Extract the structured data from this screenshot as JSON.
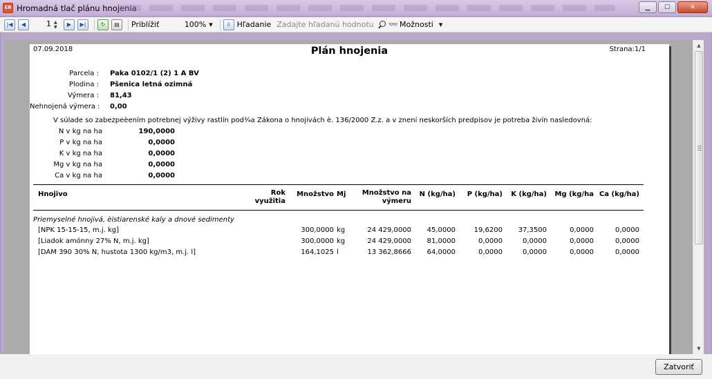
{
  "window": {
    "title": "Hromadná tlač plánu hnojenia",
    "app_icon": "ER"
  },
  "toolbar": {
    "page_number": "1",
    "zoom_label": "Priblížiť",
    "zoom_value": "100%",
    "search_label": "Hľadanie",
    "search_placeholder": "Zadajte hľadanú hodnotu",
    "options_label": "Možnosti"
  },
  "report": {
    "date": "07.09.2018",
    "title": "Plán hnojenia",
    "page": "Strana:1/1",
    "info": [
      {
        "label": "Parcela :",
        "value": "Paka 0102/1 (2) 1 A BV"
      },
      {
        "label": "Plodina :",
        "value": "Pšenica letná ozimná"
      },
      {
        "label": "Výmera :",
        "value": "81,43"
      },
      {
        "label": "Nehnojená výmera :",
        "value": "0,00"
      }
    ],
    "intro": "V súlade so zabezpeèením potrebnej výživy rastlín pod¾a Zákona o hnojivách è. 136/2000 Z.z. a v znení neskorších predpisov je potreba živín nasledovná:",
    "nutrients": [
      {
        "label": "N v kg na ha",
        "value": "190,0000"
      },
      {
        "label": "P v kg na ha",
        "value": "0,0000"
      },
      {
        "label": "K v kg na ha",
        "value": "0,0000"
      },
      {
        "label": "Mg v kg na ha",
        "value": "0,0000"
      },
      {
        "label": "Ca v kg na ha",
        "value": "0,0000"
      }
    ],
    "columns": {
      "fertilizer": "Hnojivo",
      "year_use_1": "Rok",
      "year_use_2": "využitia",
      "quantity": "Množstvo",
      "unit": "Mj",
      "qty_area_1": "Množstvo na",
      "qty_area_2": "výmeru",
      "n": "N (kg/ha)",
      "p": "P (kg/ha)",
      "k": "K (kg/ha)",
      "mg": "Mg (kg/ha",
      "ca": "Ca (kg/ha)"
    },
    "group": "Priemyselné hnojivá, èistiarenské kaly a dnové sedimenty",
    "rows": [
      {
        "name": "[NPK 15-15-15, m.j. kg]",
        "quantity": "300,0000",
        "unit": "kg",
        "qty_area": "24 429,0000",
        "n": "45,0000",
        "p": "19,6200",
        "k": "37,3500",
        "mg": "0,0000",
        "ca": "0,0000"
      },
      {
        "name": "[Liadok amónny 27% N, m.j. kg]",
        "quantity": "300,0000",
        "unit": "kg",
        "qty_area": "24 429,0000",
        "n": "81,0000",
        "p": "0,0000",
        "k": "0,0000",
        "mg": "0,0000",
        "ca": "0,0000"
      },
      {
        "name": "[DAM 390 30% N, hustota 1300 kg/m3, m.j. l]",
        "quantity": "164,1025",
        "unit": "l",
        "qty_area": "13 362,8666",
        "n": "64,0000",
        "p": "0,0000",
        "k": "0,0000",
        "mg": "0,0000",
        "ca": "0,0000"
      }
    ]
  },
  "footer": {
    "close_label": "Zatvoriť"
  }
}
